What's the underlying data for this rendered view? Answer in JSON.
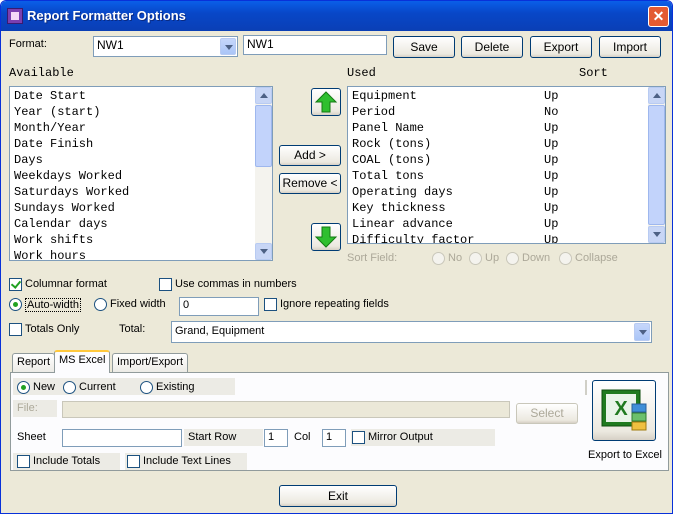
{
  "window": {
    "title": "Report Formatter Options",
    "close_label": "✕"
  },
  "format": {
    "label": "Format:",
    "selected": "NW1",
    "name_value": "NW1",
    "buttons": {
      "save": "Save",
      "delete": "Delete",
      "export": "Export",
      "import": "Import"
    }
  },
  "available": {
    "heading": "Available",
    "items": [
      "Date Start",
      "Year (start)",
      "Month/Year",
      "Date Finish",
      "Days",
      "Weekdays Worked",
      "Saturdays Worked",
      "Sundays Worked",
      "Calendar days",
      "Work shifts",
      "Work hours"
    ]
  },
  "move_buttons": {
    "add": "Add >",
    "remove": "Remove <",
    "up_icon": "green-up-arrow",
    "down_icon": "green-down-arrow"
  },
  "used": {
    "heading": "Used",
    "sort_heading": "Sort",
    "items": [
      {
        "name": "Equipment",
        "sort": "Up"
      },
      {
        "name": "Period",
        "sort": "No"
      },
      {
        "name": "Panel Name",
        "sort": "Up"
      },
      {
        "name": "Rock (tons)",
        "sort": "Up"
      },
      {
        "name": "COAL (tons)",
        "sort": "Up"
      },
      {
        "name": "Total tons",
        "sort": "Up"
      },
      {
        "name": "Operating days",
        "sort": "Up"
      },
      {
        "name": "Key thickness",
        "sort": "Up"
      },
      {
        "name": "Linear advance",
        "sort": "Up"
      },
      {
        "name": "Difficulty factor",
        "sort": "Up"
      }
    ]
  },
  "sort_field": {
    "label": "Sort Field:",
    "options": [
      "No",
      "Up",
      "Down",
      "Collapse"
    ]
  },
  "options": {
    "columnar_format": "Columnar format",
    "columnar_checked": true,
    "use_commas": "Use commas in numbers",
    "use_commas_checked": false,
    "auto_width": "Auto-width",
    "fixed_width": "Fixed width",
    "width_value": "0",
    "ignore_repeating": "Ignore repeating fields",
    "totals_only": "Totals Only",
    "total_label": "Total:",
    "total_selected": "Grand, Equipment"
  },
  "tabs": [
    "Report",
    "MS Excel",
    "Import/Export"
  ],
  "excel": {
    "new": "New",
    "current": "Current",
    "existing": "Existing",
    "file_label": "File:",
    "file_value": "",
    "select_button": "Select",
    "sheet_label": "Sheet",
    "sheet_value": "",
    "start_row_label": "Start Row",
    "start_row_value": "1",
    "col_label": "Col",
    "col_value": "1",
    "mirror_output": "Mirror Output",
    "include_totals": "Include Totals",
    "include_text_lines": "Include Text Lines",
    "export_icon": "excel-icon",
    "export_label": "Export to Excel"
  },
  "exit_button": "Exit",
  "colors": {
    "title_bar": "#0a50d8",
    "dialog_bg": "#ece9d8",
    "check_green": "#21a121",
    "tab_highlight": "#ffc83c"
  }
}
